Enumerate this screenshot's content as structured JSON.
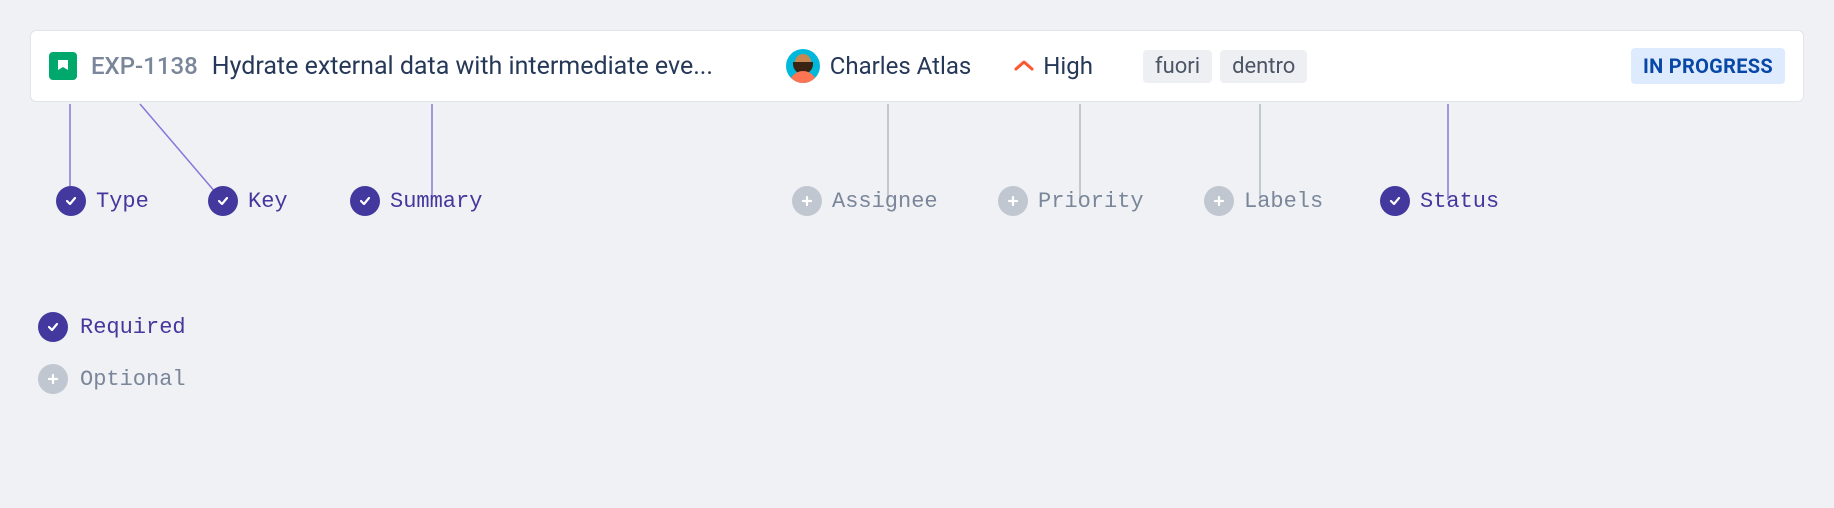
{
  "issue": {
    "key": "EXP-1138",
    "summary": "Hydrate external data with intermediate eve...",
    "assignee": "Charles Atlas",
    "priority": "High",
    "labels": [
      "fuori",
      "dentro"
    ],
    "status": "IN PROGRESS"
  },
  "fields": {
    "type": {
      "label": "Type",
      "required": true
    },
    "key": {
      "label": "Key",
      "required": true
    },
    "summary": {
      "label": "Summary",
      "required": true
    },
    "assignee": {
      "label": "Assignee",
      "required": false
    },
    "priority": {
      "label": "Priority",
      "required": false
    },
    "labels": {
      "label": "Labels",
      "required": false
    },
    "status": {
      "label": "Status",
      "required": true
    }
  },
  "legend": {
    "required": "Required",
    "optional": "Optional"
  }
}
